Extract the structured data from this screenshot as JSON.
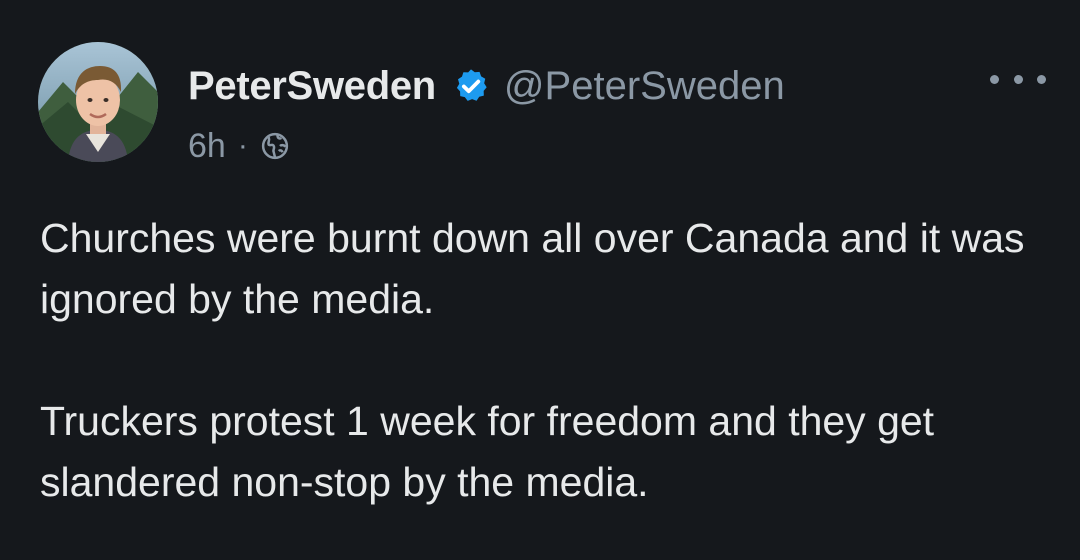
{
  "author": {
    "display_name": "PeterSweden",
    "handle": "@PeterSweden",
    "verified": true,
    "verified_color": "#1d9bf0"
  },
  "meta": {
    "time": "6h",
    "separator": "·",
    "audience_icon": "globe-icon"
  },
  "tweet": {
    "paragraphs": [
      "Churches were burnt down all over Canada and it was ignored by the media.",
      "Truckers protest 1 week for freedom and they get slandered non-stop by the media."
    ]
  },
  "colors": {
    "background": "#15181c",
    "text_primary": "#e7e9ea",
    "text_secondary": "#8b98a5"
  }
}
